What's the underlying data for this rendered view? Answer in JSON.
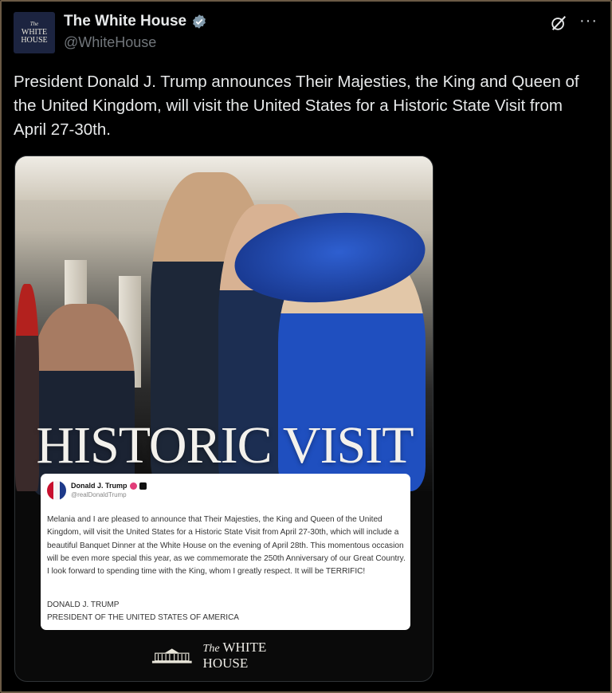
{
  "account": {
    "avatar_lines": [
      "The",
      "WHITE",
      "HOUSE"
    ],
    "display_name": "The White House",
    "handle": "@WhiteHouse",
    "verified_color": "#829aab"
  },
  "header_icons": {
    "grok": "grok-icon",
    "more": "···"
  },
  "tweet": {
    "text": "President Donald J. Trump announces Their Majesties, the King and Queen of the United Kingdom, will visit the United States for a Historic State Visit from April 27-30th."
  },
  "media": {
    "headline": "HISTORIC VISIT",
    "hat_color": "#1f4fbf",
    "embedded_post": {
      "author": "Donald J. Trump",
      "handle": "@realDonaldTrump",
      "body": "Melania and I are pleased to announce that Their Majesties, the King and Queen of the United Kingdom, will visit the United States for a Historic State Visit from April 27-30th, which will include a beautiful Banquet Dinner at the White House on the evening of April 28th. This momentous occasion will be even more special this year, as we commemorate the 250th Anniversary of our Great Country. I look forward to spending time with the King, whom I greatly respect. It will be TERRIFIC!",
      "signature_line1": "DONALD J. TRUMP",
      "signature_line2": "PRESIDENT OF THE UNITED STATES OF AMERICA"
    },
    "footer": {
      "the": "The",
      "name": "WHITE HOUSE"
    }
  }
}
